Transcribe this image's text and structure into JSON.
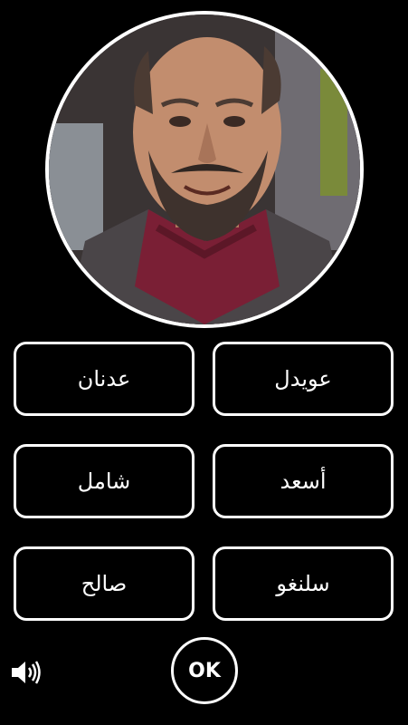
{
  "question": {
    "photo_icon": "portrait-photo"
  },
  "answers": [
    {
      "label": "عويدل"
    },
    {
      "label": "عدنان"
    },
    {
      "label": "أسعد"
    },
    {
      "label": "شامل"
    },
    {
      "label": "سلنغو"
    },
    {
      "label": "صالح"
    }
  ],
  "controls": {
    "ok_label": "OK",
    "sound_icon": "speaker-icon"
  },
  "colors": {
    "background": "#000000",
    "foreground": "#ffffff"
  }
}
